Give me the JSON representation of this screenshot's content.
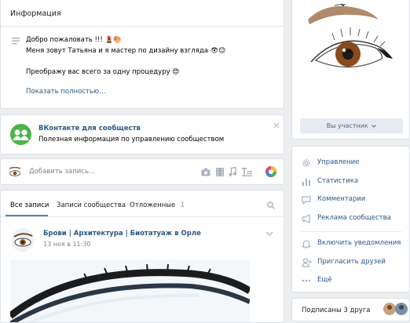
{
  "info": {
    "title": "Информация",
    "line1": "Добро пожаловать !!! 💄🎨",
    "line2": "Меня зовут Татьяна и я мастер по дизайну взгляда 👁😊",
    "line3": "Преображу вас всего за одну процедуру 😍",
    "more": "Показать полностью…"
  },
  "promo": {
    "title": "ВКонтакте для сообществ",
    "text": "Полезная информация по управлению сообществом"
  },
  "composer": {
    "placeholder": "Добавить запись..."
  },
  "tabs": {
    "all": "Все записи",
    "community": "Записи сообщества",
    "postponed": "Отложенные",
    "postponed_count": "1"
  },
  "post": {
    "author": "Брови | Архитектура | Биотатуаж в Орле",
    "date": "13 ноя в 11:30"
  },
  "sidebar": {
    "member_button": "Вы участник",
    "menu": [
      {
        "label": "Управление",
        "icon": "gear-icon"
      },
      {
        "label": "Статистика",
        "icon": "stats-icon"
      },
      {
        "label": "Комментарии",
        "icon": "comment-icon"
      },
      {
        "label": "Реклама сообщества",
        "icon": "megaphone-icon"
      },
      {
        "label": "Включить уведомления",
        "icon": "bell-icon"
      },
      {
        "label": "Пригласить друзей",
        "icon": "add-person-icon"
      },
      {
        "label": "Ещё",
        "icon": "more-icon"
      }
    ],
    "subscribers": "Подписаны 3 друга"
  },
  "colors": {
    "background": "#edeef0",
    "link": "#2a5885",
    "accent": "#5181b8",
    "promo_green": "#4bb34b",
    "eye_brown": "#8b4a1c"
  }
}
